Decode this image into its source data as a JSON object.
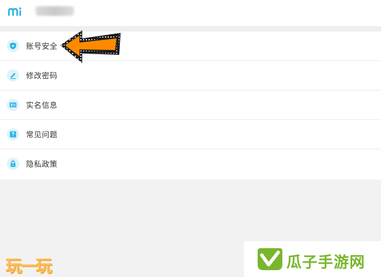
{
  "header": {
    "logo_text": "mi",
    "username": ""
  },
  "menu": {
    "items": [
      {
        "label": "账号安全",
        "icon": "shield-icon"
      },
      {
        "label": "修改密码",
        "icon": "pencil-icon"
      },
      {
        "label": "实名信息",
        "icon": "id-card-icon"
      },
      {
        "label": "常见问题",
        "icon": "question-icon"
      },
      {
        "label": "隐私政策",
        "icon": "lock-icon"
      }
    ]
  },
  "watermarks": {
    "left_text": "玩一玩",
    "right_text": "瓜子手游网"
  },
  "colors": {
    "accent": "#2bb3e6",
    "icon_bg": "#dff3fb",
    "arrow": "#ff8a00",
    "watermark_green": "#78b62b",
    "watermark_orange": "#ffbe55"
  }
}
